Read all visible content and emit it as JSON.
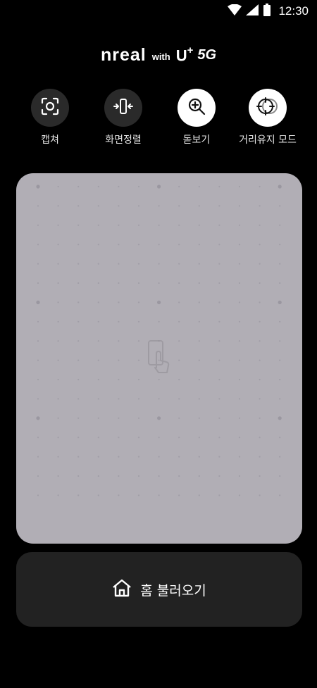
{
  "status_bar": {
    "time": "12:30",
    "icons": [
      "wifi-icon",
      "cellular-signal-icon",
      "battery-icon"
    ]
  },
  "brand": {
    "logo": "nreal",
    "with": "with",
    "partner": "U",
    "partner_sup": "+",
    "network": "5G"
  },
  "toolbar": {
    "items": [
      {
        "label": "캡쳐",
        "icon": "screenshot-capture-icon",
        "style": "dark"
      },
      {
        "label": "화면정렬",
        "icon": "screen-align-icon",
        "style": "dark"
      },
      {
        "label": "돋보기",
        "icon": "magnifier-zoom-icon",
        "style": "light"
      },
      {
        "label": "거리유지 모드",
        "icon": "distance-keep-icon",
        "style": "light"
      }
    ]
  },
  "panel": {
    "background": "#b1aeb5",
    "icon": "phone-touch-icon"
  },
  "home_button": {
    "label": "홈 불러오기",
    "icon": "home-icon"
  },
  "colors": {
    "background": "#000000",
    "button_dark": "#2a2a2a",
    "home_button_bg": "#222222"
  }
}
